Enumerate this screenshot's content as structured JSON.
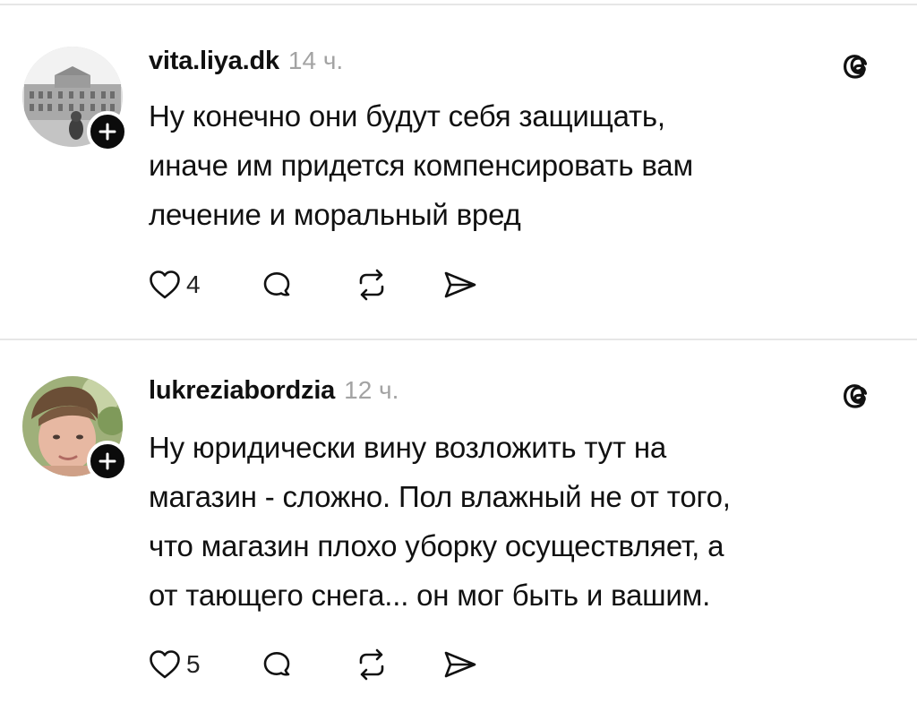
{
  "posts": [
    {
      "username": "vita.liya.dk",
      "time": "14 ч.",
      "text_lines": [
        "Ну конечно они будут себя защищать,",
        "иначе им придется компенсировать вам",
        "лечение и моральный вред"
      ],
      "likes": "4",
      "avatar": "building-photo-avatar",
      "icons": [
        "heart-icon",
        "comment-icon",
        "repost-icon",
        "share-icon",
        "threads-logo-icon"
      ]
    },
    {
      "username": "lukreziabordzia",
      "time": "12 ч.",
      "text_lines": [
        "Ну юридически вину возложить тут на",
        "магазин - сложно. Пол влажный не от того,",
        "что магазин плохо уборку осуществляет, а",
        "от тающего снега... он мог быть и вашим."
      ],
      "likes": "5",
      "avatar": "person-photo-avatar",
      "icons": [
        "heart-icon",
        "comment-icon",
        "repost-icon",
        "share-icon",
        "threads-logo-icon"
      ]
    }
  ],
  "colors": {
    "text": "#111111",
    "muted": "#a3a3a3",
    "divider": "#e6e6e6",
    "badge": "#0b0b0b"
  }
}
